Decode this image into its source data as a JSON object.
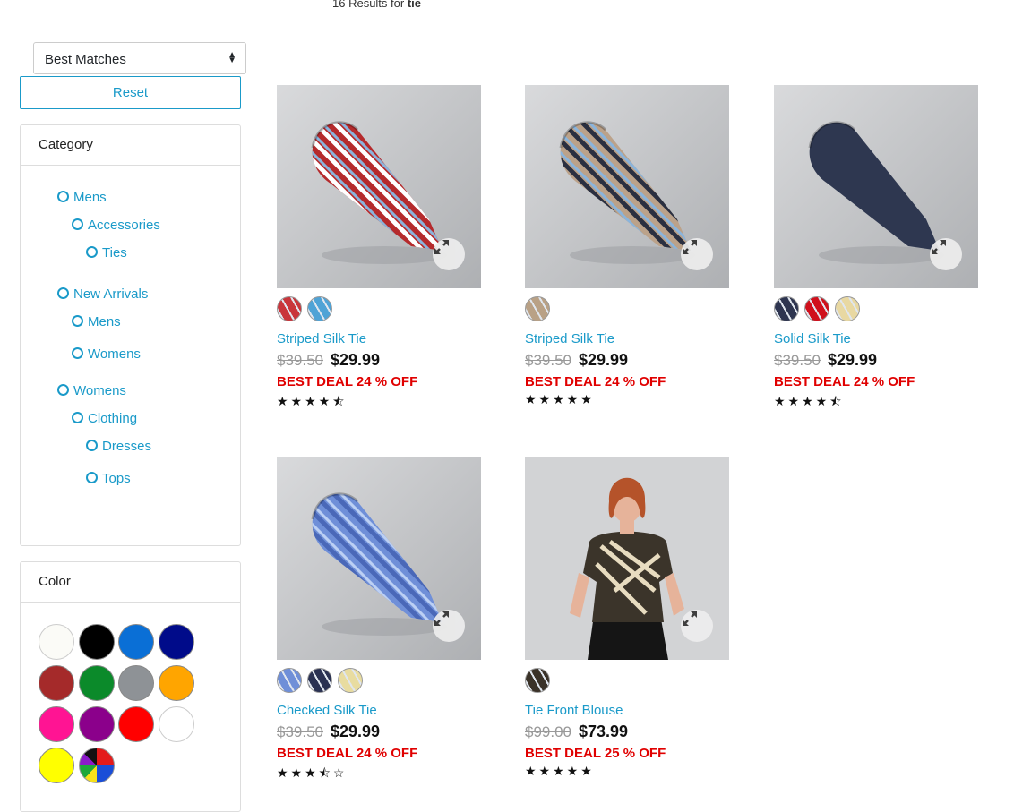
{
  "results": {
    "count": "16 Results for",
    "query": "tie"
  },
  "sort": {
    "selected": "Best Matches"
  },
  "reset_label": "Reset",
  "category_panel": {
    "title": "Category",
    "items": [
      {
        "label": "Mens"
      },
      {
        "label": "Accessories"
      },
      {
        "label": "Ties"
      },
      {
        "label": "New Arrivals"
      },
      {
        "label": "Mens"
      },
      {
        "label": "Womens"
      },
      {
        "label": "Womens"
      },
      {
        "label": "Clothing"
      },
      {
        "label": "Dresses"
      },
      {
        "label": "Tops"
      }
    ]
  },
  "color_panel": {
    "title": "Color",
    "swatches": [
      "#fbfbf7",
      "#000000",
      "#0a6fd6",
      "#000b8a",
      "#a52a2a",
      "#0b8a2a",
      "#8e9296",
      "#ffa500",
      "#ff1493",
      "#8b008b",
      "#ff0000",
      "#ffffff",
      "#ffff00",
      "multicolor"
    ]
  },
  "products": [
    {
      "name": "Striped Silk Tie",
      "old_price": "$39.50",
      "price": "$29.99",
      "deal": "BEST DEAL 24 % OFF",
      "rating": 4.5,
      "tie_color": "#b52a2c",
      "stripe": "#8ab4dc",
      "stripe2": "#ffffff",
      "swatch_colors": [
        "#c9353b",
        "#4fa3d6"
      ]
    },
    {
      "name": "Striped Silk Tie",
      "old_price": "$39.50",
      "price": "$29.99",
      "deal": "BEST DEAL 24 % OFF",
      "rating": 5,
      "tie_color": "#bba28a",
      "stripe": "#8ab4dc",
      "stripe2": "#2a2f40",
      "swatch_colors": [
        "#b9a186"
      ]
    },
    {
      "name": "Solid Silk Tie",
      "old_price": "$39.50",
      "price": "$29.99",
      "deal": "BEST DEAL 24 % OFF",
      "rating": 4.5,
      "tie_color": "#2e3750",
      "stripe": "#2e3750",
      "stripe2": "#2e3750",
      "swatch_colors": [
        "#2e3550",
        "#d0101c",
        "#e8d8a2"
      ]
    },
    {
      "name": "Checked Silk Tie",
      "old_price": "$39.50",
      "price": "$29.99",
      "deal": "BEST DEAL 24 % OFF",
      "rating": 3.5,
      "tie_color": "#6f8fd8",
      "stripe": "#bcd0f4",
      "stripe2": "#4a68b8",
      "swatch_colors": [
        "#6f8fd8",
        "#2a3152",
        "#e8dca0"
      ]
    },
    {
      "name": "Tie Front Blouse",
      "old_price": "$99.00",
      "price": "$73.99",
      "deal": "BEST DEAL 25 % OFF",
      "rating": 5,
      "tie_color": "",
      "stripe": "",
      "stripe2": "",
      "swatch_colors": [
        "#3a3228"
      ]
    }
  ]
}
